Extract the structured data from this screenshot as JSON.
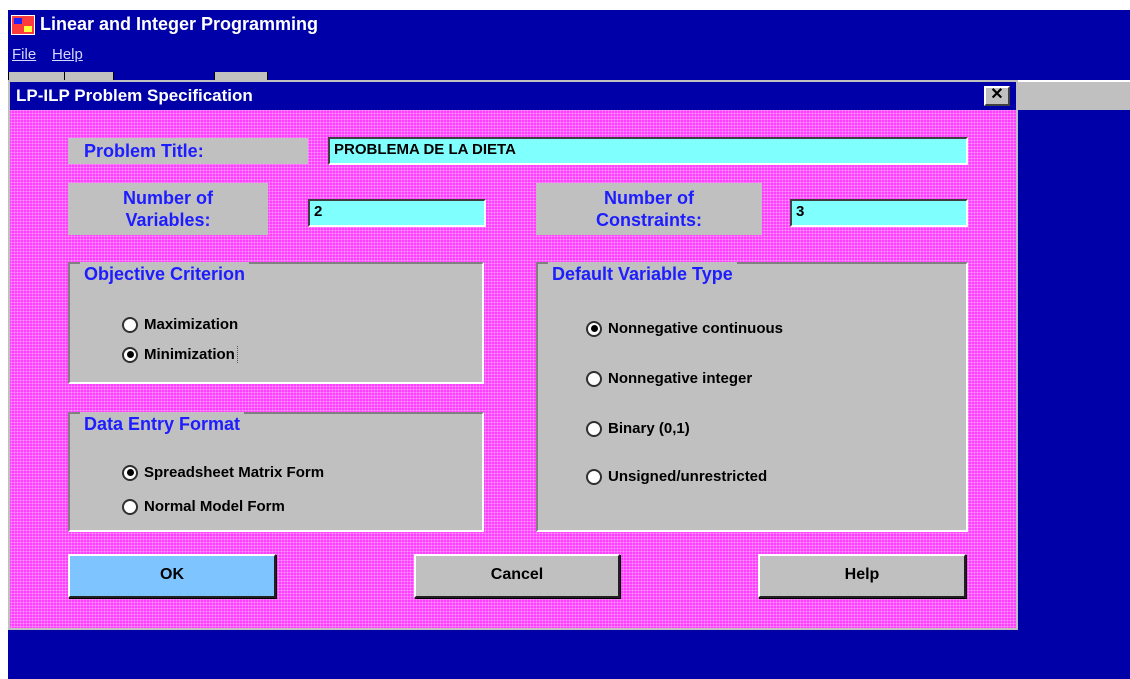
{
  "app": {
    "title": "Linear and Integer Programming",
    "menu": [
      {
        "label": "File"
      },
      {
        "label": "Help"
      }
    ]
  },
  "dialog": {
    "title": "LP-ILP Problem Specification",
    "close_glyph": "✕",
    "problem_title_label": "Problem Title:",
    "problem_title_value": "PROBLEMA DE LA DIETA",
    "num_variables_label_1": "Number of",
    "num_variables_label_2": "Variables:",
    "num_variables_value": "2",
    "num_constraints_label_1": "Number of",
    "num_constraints_label_2": "Constraints:",
    "num_constraints_value": "3",
    "objective": {
      "title": "Objective Criterion",
      "options": [
        {
          "label": "Maximization",
          "checked": false
        },
        {
          "label": "Minimization",
          "checked": true
        }
      ]
    },
    "data_entry": {
      "title": "Data Entry Format",
      "options": [
        {
          "label": "Spreadsheet Matrix Form",
          "checked": true
        },
        {
          "label": "Normal Model Form",
          "checked": false
        }
      ]
    },
    "variable_type": {
      "title": "Default Variable Type",
      "options": [
        {
          "label": "Nonnegative continuous",
          "checked": true
        },
        {
          "label": "Nonnegative integer",
          "checked": false
        },
        {
          "label": "Binary (0,1)",
          "checked": false
        },
        {
          "label": "Unsigned/unrestricted",
          "checked": false
        }
      ]
    },
    "buttons": {
      "ok": "OK",
      "cancel": "Cancel",
      "help": "Help"
    }
  }
}
